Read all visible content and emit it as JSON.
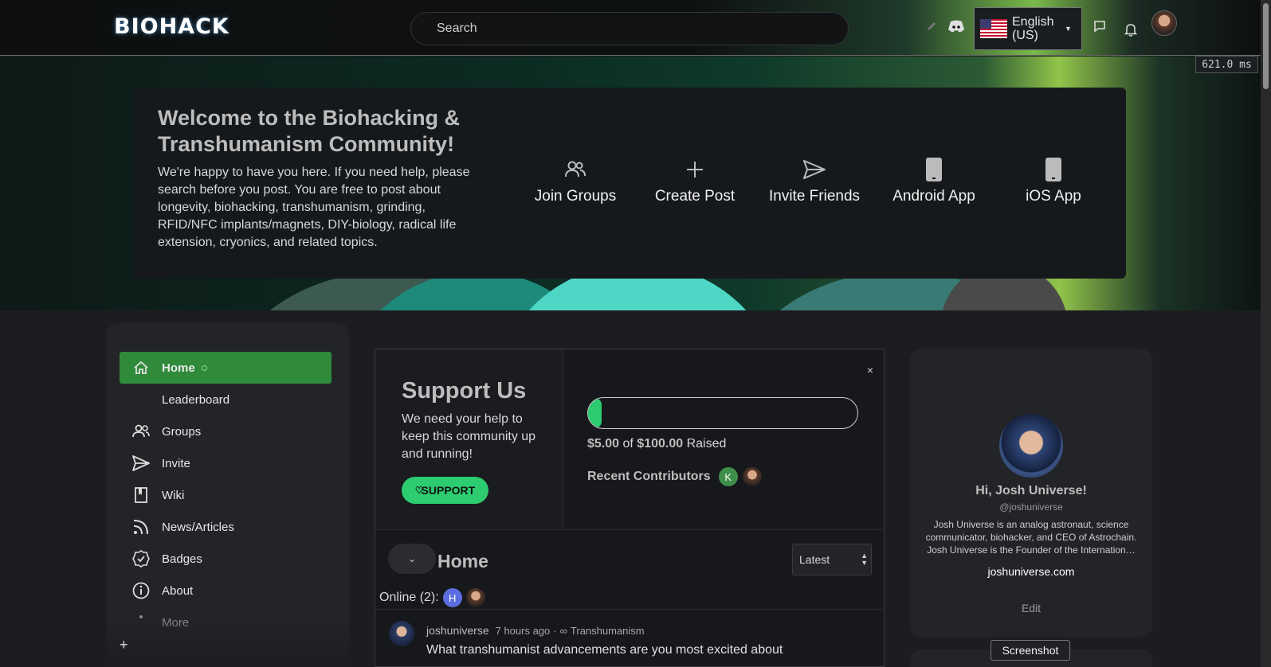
{
  "topbar": {
    "logo_text": "BIOHACK",
    "search_placeholder": "Search",
    "language_label": "English (US)",
    "timing": "621.0 ms"
  },
  "welcome": {
    "title": "Welcome to the Biohacking & Transhumanism Community!",
    "body": "We're happy to have you here. If you need help, please search before you post. You are free to post about longevity, biohacking, transhumanism, grinding, RFID/NFC implants/magnets, DIY-biology, radical life extension, cryonics, and related topics.",
    "actions": [
      {
        "label": "Join Groups",
        "icon": "users-icon"
      },
      {
        "label": "Create Post",
        "icon": "plus-icon"
      },
      {
        "label": "Invite Friends",
        "icon": "send-icon"
      },
      {
        "label": "Android App",
        "icon": "phone-icon"
      },
      {
        "label": "iOS App",
        "icon": "phone-icon"
      }
    ]
  },
  "sidebar": {
    "items": [
      {
        "label": "Home",
        "icon": "home-icon",
        "active": true
      },
      {
        "label": "Leaderboard",
        "icon": ""
      },
      {
        "label": "Groups",
        "icon": "users-icon"
      },
      {
        "label": "Invite",
        "icon": "send-icon"
      },
      {
        "label": "Wiki",
        "icon": "book-icon"
      },
      {
        "label": "News/Articles",
        "icon": "rss-icon"
      },
      {
        "label": "Badges",
        "icon": "badge-icon"
      },
      {
        "label": "About",
        "icon": "info-icon"
      },
      {
        "label": "More",
        "icon": "more-icon"
      }
    ],
    "add_label": "+"
  },
  "support": {
    "title": "Support Us",
    "text": "We need your help to keep this community up and running!",
    "button": "SUPPORT",
    "close": "×",
    "progress_fraction": 0.05,
    "raised_amount": "$5.00",
    "raised_of": "of",
    "raised_goal": "$100.00",
    "raised_suffix": "Raised",
    "contributors_label": "Recent Contributors",
    "contributor_initial": "K"
  },
  "feed": {
    "collapse_icon": "chevron-down-icon",
    "title": "Home",
    "sort_value": "Latest",
    "online_label": "Online (2):",
    "online_initial": "H"
  },
  "post": {
    "username": "joshuniverse",
    "time": "7 hours ago",
    "separator": "·",
    "group": "Transhumanism",
    "text": "What transhumanist advancements are you most excited about"
  },
  "profile": {
    "greeting": "Hi, Josh Universe!",
    "handle": "@joshuniverse",
    "bio": "Josh Universe is an analog astronaut, science communicator, biohacker, and CEO of Astrochain. Josh Universe is the Founder of the Internation…",
    "website": "joshuniverse.com",
    "edit": "Edit"
  },
  "tooltip": "Screenshot",
  "colors": {
    "accent_green": "#2ecc71",
    "nav_active": "#2f8a3a",
    "card_bg": "#222427",
    "page_bg": "#1b1d20"
  }
}
